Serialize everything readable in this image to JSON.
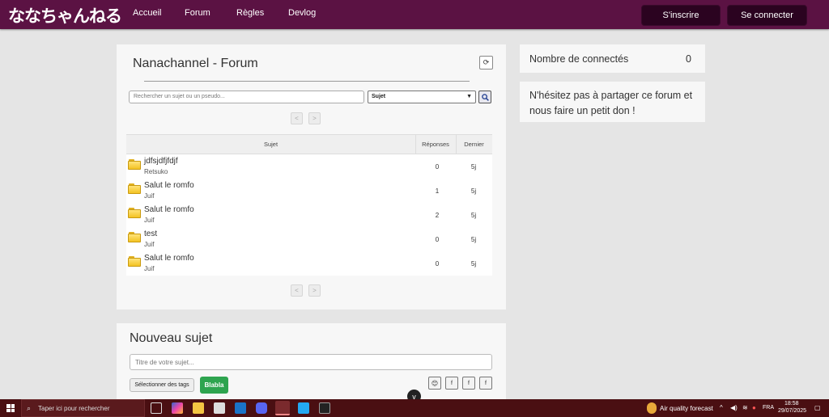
{
  "header": {
    "logo": "ななちゃんねる",
    "nav": [
      "Accueil",
      "Forum",
      "Règles",
      "Devlog"
    ],
    "signup_label": "S'inscrire",
    "login_label": "Se connecter"
  },
  "forum": {
    "title": "Nanachannel - Forum",
    "refresh_icon": "⟳",
    "search_placeholder": "Rechercher un sujet ou un pseudo...",
    "filter_selected": "Sujet",
    "pager_prev": "<",
    "pager_next": ">",
    "columns": {
      "subject": "Sujet",
      "replies": "Réponses",
      "last": "Dernier"
    },
    "threads": [
      {
        "title": "jdfsjdfjfdjf",
        "author": "Retsuko",
        "replies": "0",
        "last": "5j"
      },
      {
        "title": "Salut le romfo",
        "author": "Juif",
        "replies": "1",
        "last": "5j"
      },
      {
        "title": "Salut le romfo",
        "author": "Juif",
        "replies": "2",
        "last": "5j"
      },
      {
        "title": "test",
        "author": "Juif",
        "replies": "0",
        "last": "5j"
      },
      {
        "title": "Salut le romfo",
        "author": "Juif",
        "replies": "0",
        "last": "5j"
      }
    ]
  },
  "new_topic": {
    "title": "Nouveau sujet",
    "title_placeholder": "Titre de votre sujet...",
    "tags_button": "Sélectionner des tags",
    "tag_blabla": "Blabla",
    "emoji_icon": "😊",
    "tool_f1": "f",
    "tool_f2": "f",
    "tool_f3": "f"
  },
  "sidebar": {
    "online_label": "Nombre de connectés",
    "online_count": "0",
    "donate_text": "N'hésitez pas à partager ce forum et nous faire un petit don !"
  },
  "scroll_icon": "v",
  "taskbar": {
    "search_placeholder": "Taper ici pour rechercher",
    "weather": "Air quality forecast",
    "lang": "FRA",
    "time": "18:58",
    "date": "29/07/2025"
  },
  "colors": {
    "header_bg": "#5b1243",
    "button_dark": "#2b0320",
    "blabla_green": "#2ea44f",
    "taskbar_bg": "#4a0f12"
  }
}
